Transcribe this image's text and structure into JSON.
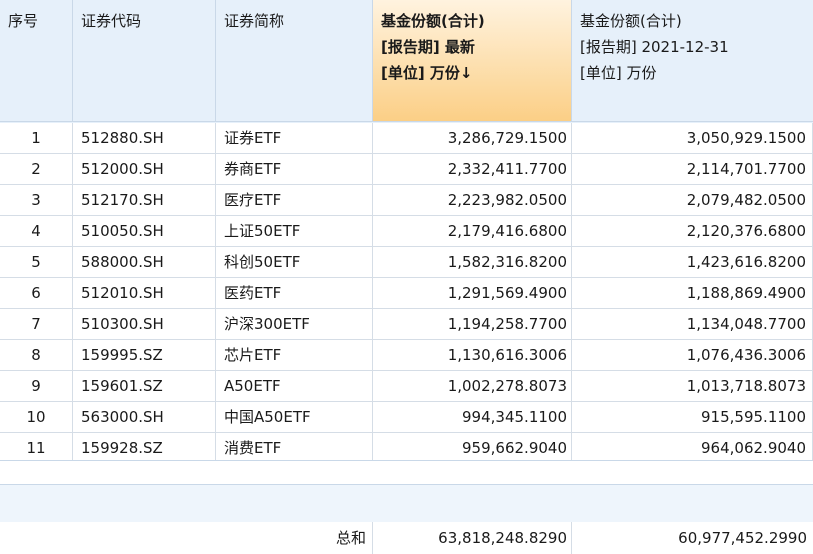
{
  "headers": {
    "seq": "序号",
    "code": "证券代码",
    "name": "证券简称",
    "col_latest": [
      "基金份额(合计)",
      "[报告期] 最新",
      "[单位] 万份↓"
    ],
    "col_2021": [
      "基金份额(合计)",
      "[报告期] 2021-12-31",
      "[单位] 万份"
    ]
  },
  "rows": [
    {
      "seq": "1",
      "code": "512880.SH",
      "name": "证券ETF",
      "latest": "3,286,729.1500",
      "prev": "3,050,929.1500"
    },
    {
      "seq": "2",
      "code": "512000.SH",
      "name": "券商ETF",
      "latest": "2,332,411.7700",
      "prev": "2,114,701.7700"
    },
    {
      "seq": "3",
      "code": "512170.SH",
      "name": "医疗ETF",
      "latest": "2,223,982.0500",
      "prev": "2,079,482.0500"
    },
    {
      "seq": "4",
      "code": "510050.SH",
      "name": "上证50ETF",
      "latest": "2,179,416.6800",
      "prev": "2,120,376.6800"
    },
    {
      "seq": "5",
      "code": "588000.SH",
      "name": "科创50ETF",
      "latest": "1,582,316.8200",
      "prev": "1,423,616.8200"
    },
    {
      "seq": "6",
      "code": "512010.SH",
      "name": "医药ETF",
      "latest": "1,291,569.4900",
      "prev": "1,188,869.4900"
    },
    {
      "seq": "7",
      "code": "510300.SH",
      "name": "沪深300ETF",
      "latest": "1,194,258.7700",
      "prev": "1,134,048.7700"
    },
    {
      "seq": "8",
      "code": "159995.SZ",
      "name": "芯片ETF",
      "latest": "1,130,616.3006",
      "prev": "1,076,436.3006"
    },
    {
      "seq": "9",
      "code": "159601.SZ",
      "name": "A50ETF",
      "latest": "1,002,278.8073",
      "prev": "1,013,718.8073"
    },
    {
      "seq": "10",
      "code": "563000.SH",
      "name": "中国A50ETF",
      "latest": "994,345.1100",
      "prev": "915,595.1100"
    },
    {
      "seq": "11",
      "code": "159928.SZ",
      "name": "消费ETF",
      "latest": "959,662.9040",
      "prev": "964,062.9040"
    }
  ],
  "totals": {
    "label": "总和",
    "latest": "63,818,248.8290",
    "prev": "60,977,452.2990"
  }
}
